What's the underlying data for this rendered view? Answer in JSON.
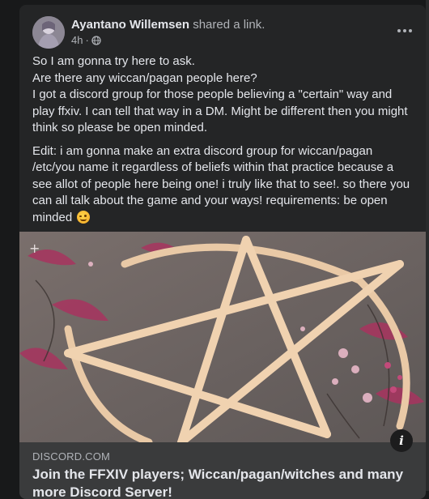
{
  "post": {
    "author": "Ayantano Willemsen",
    "action": "shared a link.",
    "time": "4h",
    "separator": "·",
    "paragraphs": [
      "So I am gonna try here to ask.",
      "Are there any wiccan/pagan people here?",
      "I got a discord group for those people believing a \"certain\" way and play ffxiv. I can tell that way in a DM. Might be different then you might think so please be open minded."
    ],
    "edit_paragraph": "Edit: i am gonna make an extra discord group for wiccan/pagan /etc/you name it regardless of beliefs within that practice because a see allot of people here being one! i truly like that to see!. so there you can all talk about the game and your ways! requirements: be open minded"
  },
  "link": {
    "domain": "DISCORD.COM",
    "title": "Join the FFXIV players; Wiccan/pagan/witches and many more Discord Server!",
    "info_label": "i"
  },
  "icons": {
    "privacy": "globe-icon",
    "more": "more-horizontal-icon",
    "emoji": "smirk-emoji-icon",
    "info": "info-icon"
  },
  "colors": {
    "background": "#18191a",
    "card": "#242526",
    "text_primary": "#e4e6eb",
    "text_secondary": "#b0b3b8",
    "link_preview_bg": "#3a3b3c"
  }
}
